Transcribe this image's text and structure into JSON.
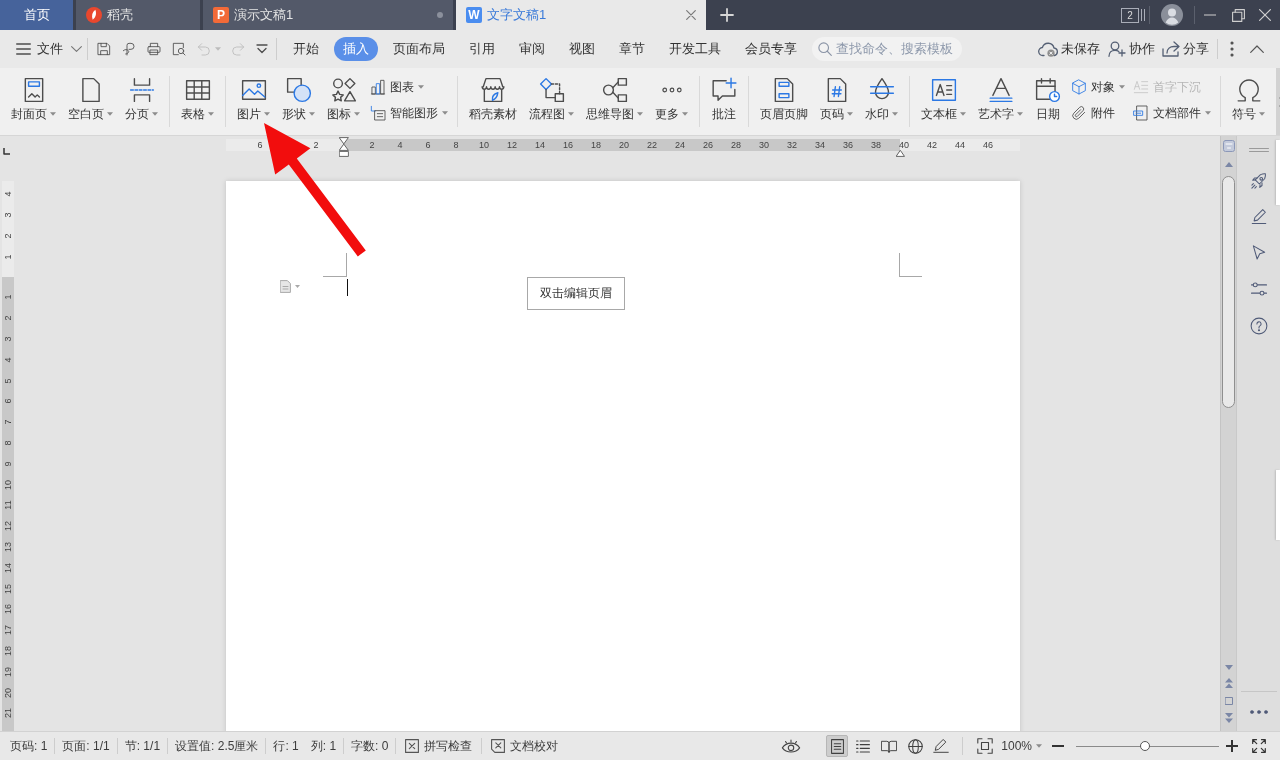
{
  "tabs": [
    {
      "kind": "home",
      "label": "首页",
      "selected": false
    },
    {
      "kind": "docer",
      "label": "稻壳",
      "selected": false
    },
    {
      "kind": "presentation",
      "logo": "P",
      "label": "演示文稿1",
      "selected": false
    },
    {
      "kind": "writer",
      "logo": "W",
      "label": "文字文稿1",
      "selected": true
    }
  ],
  "window": {
    "window_count": "2"
  },
  "menu_bar": {
    "file_label": "文件",
    "quick_access": [
      {
        "kind": "save",
        "disabled": false
      },
      {
        "kind": "export",
        "disabled": false
      },
      {
        "kind": "print",
        "disabled": false
      },
      {
        "kind": "preview",
        "disabled": false
      },
      {
        "kind": "undo",
        "disabled": true
      },
      {
        "kind": "redo",
        "disabled": true
      },
      {
        "kind": "customize",
        "disabled": false
      }
    ],
    "ribbon_tabs": [
      {
        "label": "开始",
        "selected": false
      },
      {
        "label": "插入",
        "selected": true
      },
      {
        "label": "页面布局",
        "selected": false
      },
      {
        "label": "引用",
        "selected": false
      },
      {
        "label": "审阅",
        "selected": false
      },
      {
        "label": "视图",
        "selected": false
      },
      {
        "label": "章节",
        "selected": false
      },
      {
        "label": "开发工具",
        "selected": false
      },
      {
        "label": "会员专享",
        "selected": false
      }
    ],
    "search": {
      "placeholder": "查找命令、搜索模板"
    },
    "actions": [
      {
        "kind": "cloud",
        "label": "未保存"
      },
      {
        "kind": "collaborate",
        "label": "协作"
      },
      {
        "kind": "share",
        "label": "分享"
      }
    ]
  },
  "ribbon": {
    "groups": [
      {
        "items": [
          {
            "kind": "cover_page",
            "label": "封面页",
            "dropdown": true
          },
          {
            "kind": "blank_page",
            "label": "空白页",
            "dropdown": true
          },
          {
            "kind": "page_break",
            "label": "分页",
            "dropdown": true
          }
        ]
      },
      {
        "items": [
          {
            "kind": "table",
            "label": "表格",
            "dropdown": true
          }
        ]
      },
      {
        "items": [
          {
            "kind": "picture",
            "label": "图片",
            "dropdown": true
          },
          {
            "kind": "shape",
            "label": "形状",
            "dropdown": true
          },
          {
            "kind": "icon_lib",
            "label": "图标",
            "dropdown": true
          },
          {
            "kind": "stack",
            "items": [
              {
                "kind": "chart",
                "label": "图表",
                "dropdown": true,
                "disabled": false
              },
              {
                "kind": "smart_art",
                "label": "智能图形",
                "dropdown": true,
                "disabled": false
              }
            ]
          }
        ]
      },
      {
        "items": [
          {
            "kind": "docer_assets",
            "label": "稻壳素材",
            "dropdown": false
          },
          {
            "kind": "flowchart",
            "label": "流程图",
            "dropdown": true
          },
          {
            "kind": "mind_map",
            "label": "思维导图",
            "dropdown": true
          },
          {
            "kind": "more",
            "label": "更多",
            "dropdown": true
          }
        ]
      },
      {
        "items": [
          {
            "kind": "comment",
            "label": "批注",
            "dropdown": false
          }
        ]
      },
      {
        "items": [
          {
            "kind": "header_footer",
            "label": "页眉页脚",
            "dropdown": false
          },
          {
            "kind": "page_number",
            "label": "页码",
            "dropdown": true
          },
          {
            "kind": "watermark",
            "label": "水印",
            "dropdown": true
          }
        ]
      },
      {
        "items": [
          {
            "kind": "text_box",
            "label": "文本框",
            "dropdown": true
          },
          {
            "kind": "word_art",
            "label": "艺术字",
            "dropdown": true
          },
          {
            "kind": "date",
            "label": "日期",
            "dropdown": false
          },
          {
            "kind": "stack",
            "items": [
              {
                "kind": "object",
                "label": "对象",
                "dropdown": true,
                "disabled": false
              },
              {
                "kind": "attachment",
                "label": "附件",
                "dropdown": false,
                "disabled": false
              }
            ]
          },
          {
            "kind": "stack",
            "items": [
              {
                "kind": "drop_cap",
                "label": "首字下沉",
                "dropdown": false,
                "disabled": true
              },
              {
                "kind": "doc_parts",
                "label": "文档部件",
                "dropdown": true,
                "disabled": false
              }
            ]
          }
        ]
      },
      {
        "items": [
          {
            "kind": "symbol",
            "label": "符号",
            "dropdown": true
          }
        ]
      }
    ]
  },
  "ruler": {
    "left_labels": [
      "6",
      "2"
    ],
    "labels": [
      "2",
      "4",
      "6",
      "8",
      "10",
      "12",
      "14",
      "16",
      "18",
      "20",
      "22",
      "24",
      "26",
      "28",
      "30",
      "32",
      "34",
      "36",
      "38"
    ],
    "right_labels": [
      "40",
      "42",
      "44",
      "46"
    ]
  },
  "vertical_ruler": {
    "top_labels": [
      "4",
      "3",
      "2",
      "1"
    ],
    "labels": [
      "1",
      "2",
      "3",
      "4",
      "5",
      "6",
      "7",
      "8",
      "9",
      "10",
      "11",
      "12",
      "13",
      "14",
      "15",
      "16",
      "17",
      "18",
      "19",
      "20",
      "21"
    ]
  },
  "document": {
    "header_hint": "双击编辑页眉"
  },
  "status_bar": {
    "fields": [
      [
        "页码: 1"
      ],
      [
        "页面: 1/1"
      ],
      [
        "节: 1/1"
      ],
      [
        "设置值: 2.5厘米"
      ],
      [
        "行: 1",
        "列: 1"
      ],
      [
        "字数: 0"
      ]
    ],
    "tools": [
      {
        "kind": "spellcheck",
        "label": "拼写检查"
      },
      {
        "kind": "proofread",
        "label": "文档校对"
      }
    ],
    "views": [
      {
        "kind": "page",
        "selected": true
      },
      {
        "kind": "outline",
        "selected": false
      },
      {
        "kind": "reading",
        "selected": false
      },
      {
        "kind": "web",
        "selected": false
      },
      {
        "kind": "writing",
        "selected": false
      }
    ],
    "zoom": {
      "label": "100%",
      "level": 0.48
    }
  }
}
